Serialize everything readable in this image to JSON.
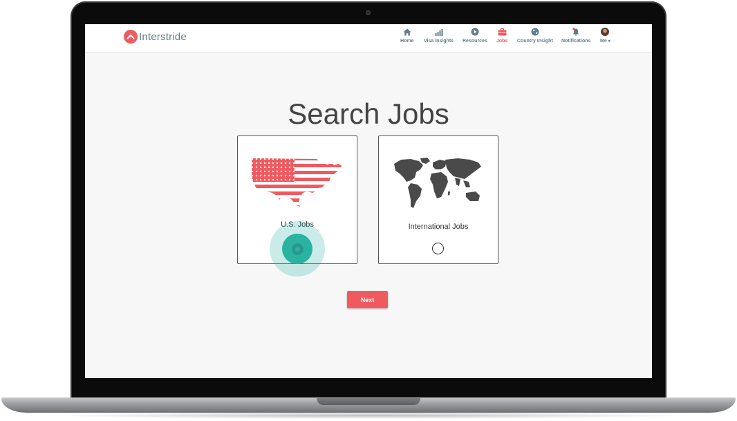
{
  "brand": {
    "name": "Interstride",
    "color": "#f05a5f"
  },
  "nav": {
    "items": [
      {
        "label": "Home",
        "icon": "home-icon"
      },
      {
        "label": "Visa Insights",
        "icon": "bar-chart-icon"
      },
      {
        "label": "Resources",
        "icon": "play-circle-icon"
      },
      {
        "label": "Jobs",
        "icon": "briefcase-icon",
        "active": true
      },
      {
        "label": "Country Insight",
        "icon": "globe-icon"
      },
      {
        "label": "Notifications",
        "icon": "bell-icon"
      },
      {
        "label": "Me",
        "icon": "avatar"
      }
    ]
  },
  "page": {
    "title": "Search Jobs"
  },
  "options": [
    {
      "label": "U.S. Jobs",
      "selected": true,
      "icon": "usa-flag-map-icon"
    },
    {
      "label": "International Jobs",
      "selected": false,
      "icon": "world-map-icon"
    }
  ],
  "actions": {
    "next_label": "Next"
  },
  "colors": {
    "accent": "#f05a5f",
    "nav_text": "#607d8b",
    "radio_selected": "#2bb3a2"
  }
}
